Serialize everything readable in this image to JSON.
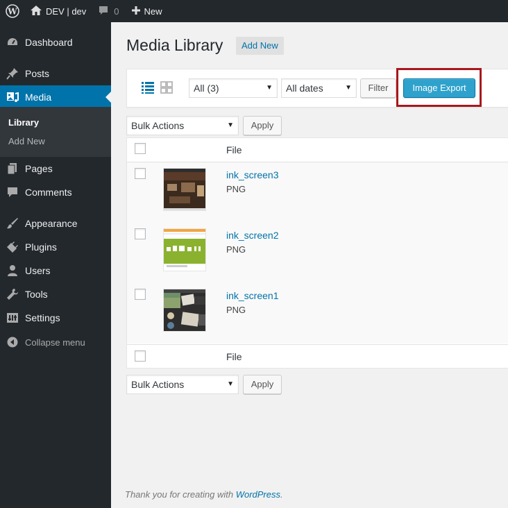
{
  "adminbar": {
    "site_name": "DEV | dev",
    "comments_count": "0",
    "new_label": "New"
  },
  "sidebar": {
    "items": [
      {
        "label": "Dashboard",
        "icon": "dashboard-icon"
      },
      {
        "label": "Posts",
        "icon": "pin-icon"
      },
      {
        "label": "Media",
        "icon": "media-icon"
      },
      {
        "label": "Pages",
        "icon": "pages-icon"
      },
      {
        "label": "Comments",
        "icon": "comment-icon"
      },
      {
        "label": "Appearance",
        "icon": "brush-icon"
      },
      {
        "label": "Plugins",
        "icon": "plug-icon"
      },
      {
        "label": "Users",
        "icon": "user-icon"
      },
      {
        "label": "Tools",
        "icon": "wrench-icon"
      },
      {
        "label": "Settings",
        "icon": "settings-icon"
      }
    ],
    "submenu": [
      "Library",
      "Add New"
    ],
    "collapse_label": "Collapse menu",
    "accent": "#0073aa"
  },
  "main": {
    "title": "Media Library",
    "add_new": "Add New",
    "filters": {
      "type_select": "All (3)",
      "date_select": "All dates",
      "filter_button": "Filter",
      "export_button": "Image Export"
    },
    "bulk_top": {
      "select": "Bulk Actions",
      "apply": "Apply"
    },
    "bulk_bottom": {
      "select": "Bulk Actions",
      "apply": "Apply"
    },
    "table": {
      "column": "File",
      "rows": [
        {
          "name": "ink_screen3",
          "type": "PNG"
        },
        {
          "name": "ink_screen2",
          "type": "PNG"
        },
        {
          "name": "ink_screen1",
          "type": "PNG"
        }
      ]
    },
    "footer": {
      "prefix": "Thank you for creating with ",
      "link": "WordPress",
      "suffix": "."
    }
  }
}
